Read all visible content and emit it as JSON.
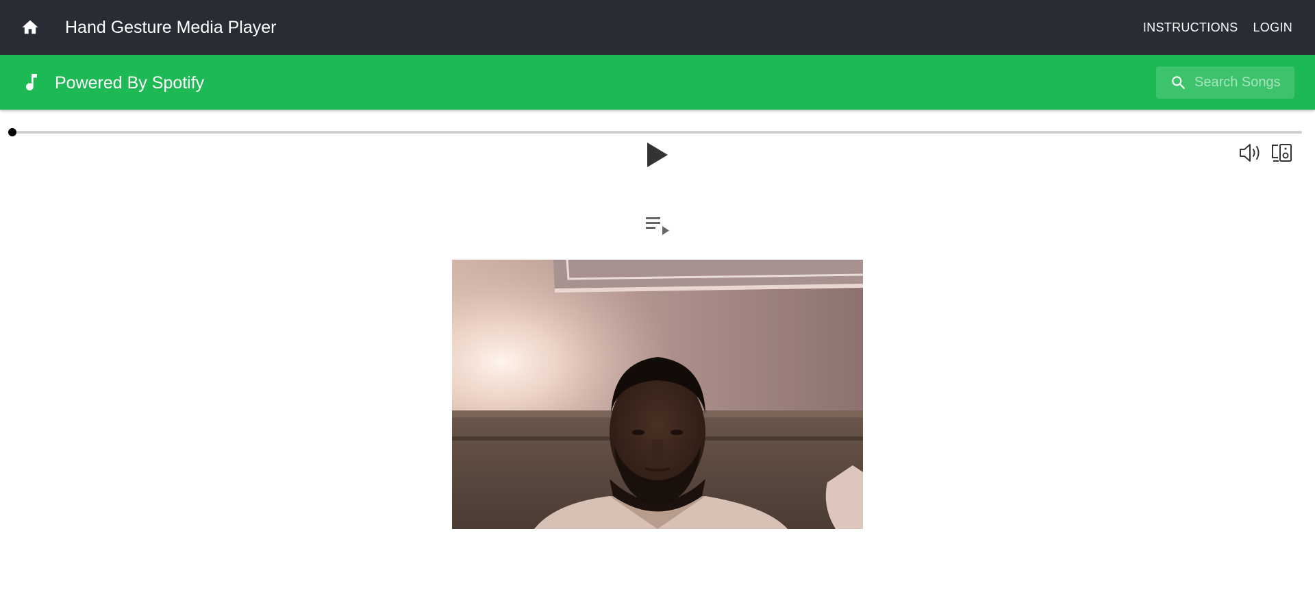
{
  "header": {
    "home_icon": "home-icon",
    "title": "Hand Gesture Media Player",
    "nav": [
      {
        "label": "INSTRUCTIONS"
      },
      {
        "label": "LOGIN"
      }
    ]
  },
  "subheader": {
    "music_icon": "music-note-icon",
    "title": "Powered By Spotify",
    "search": {
      "icon": "search-icon",
      "placeholder": "Search Songs",
      "value": ""
    }
  },
  "player": {
    "progress_fraction": 0,
    "controls": {
      "play_icon": "play-icon",
      "volume_icon": "volume-icon",
      "devices_icon": "devices-icon",
      "queue_icon": "playlist-play-icon"
    }
  },
  "webcam": {
    "content": "webcam-feed"
  },
  "colors": {
    "appbar_bg": "#282c34",
    "spotify_green": "#1db954",
    "progress_track": "#cfcfcf",
    "control_icon": "#333333"
  }
}
